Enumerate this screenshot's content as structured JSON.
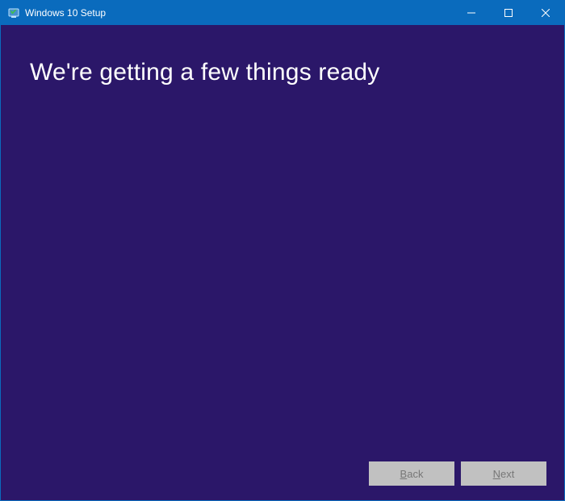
{
  "window": {
    "title": "Windows 10 Setup"
  },
  "colors": {
    "titlebar": "#0a6bbd",
    "content_bg": "#2b1769",
    "heading_text": "#ffffff",
    "button_bg": "#c1c1c1",
    "button_text": "#777777"
  },
  "main": {
    "heading": "We're getting a few things ready"
  },
  "footer": {
    "back_prefix": "B",
    "back_rest": "ack",
    "next_prefix": "N",
    "next_rest": "ext",
    "back_enabled": false,
    "next_enabled": false
  }
}
